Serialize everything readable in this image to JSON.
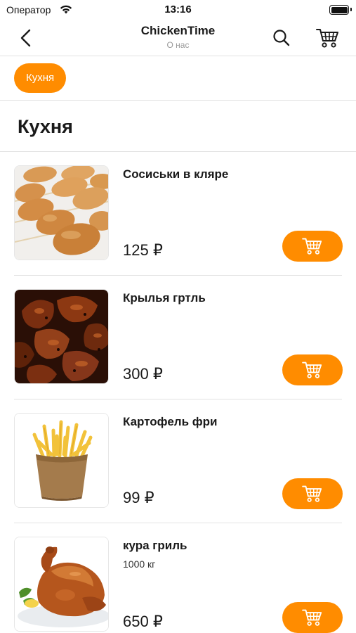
{
  "status_bar": {
    "carrier": "Оператор",
    "time": "13:16"
  },
  "nav": {
    "title": "ChickenTime",
    "subtitle": "О нас"
  },
  "categories": [
    {
      "label": "Кухня",
      "selected": true
    }
  ],
  "section": {
    "title": "Кухня"
  },
  "products": [
    {
      "name": "Сосиськи в кляре",
      "desc": "",
      "price": "125 ₽",
      "image_icon": "corn-dogs-photo"
    },
    {
      "name": "Крылья гртль",
      "desc": "",
      "price": "300 ₽",
      "image_icon": "grilled-wings-photo"
    },
    {
      "name": "Картофель фри",
      "desc": "",
      "price": "99 ₽",
      "image_icon": "french-fries-photo"
    },
    {
      "name": "кура гриль",
      "desc": "1000 кг",
      "price": "650 ₽",
      "image_icon": "roast-chicken-photo"
    }
  ],
  "colors": {
    "accent": "#ff8c00",
    "separator": "#e2e2e2",
    "subtitle": "#9a9a9a"
  }
}
